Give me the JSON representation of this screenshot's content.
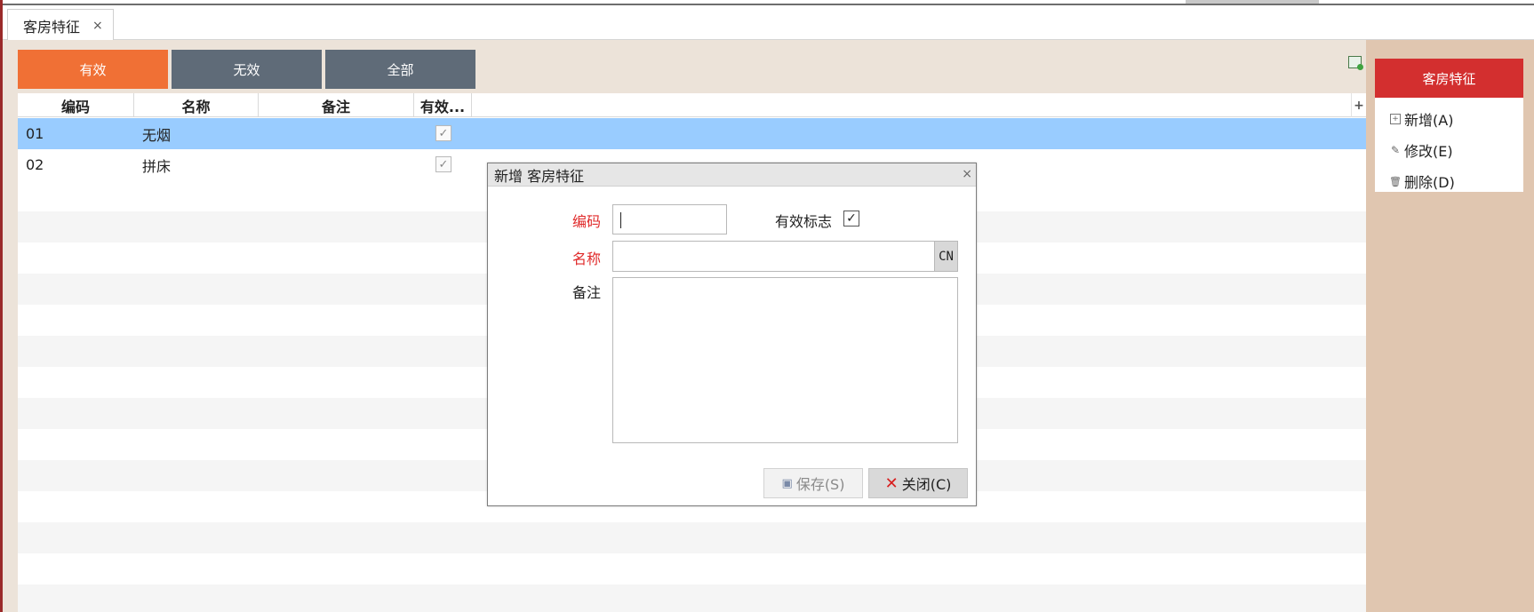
{
  "tab": {
    "title": "客房特征",
    "close": "×"
  },
  "filters": {
    "valid": "有效",
    "invalid": "无效",
    "all": "全部"
  },
  "table": {
    "columns": [
      "编码",
      "名称",
      "备注",
      "有效..."
    ],
    "add_icon": "+",
    "rows": [
      {
        "code": "01",
        "name": "无烟",
        "valid": true,
        "selected": true
      },
      {
        "code": "02",
        "name": "拼床",
        "valid": true,
        "selected": false
      }
    ]
  },
  "dialog": {
    "title": "新增 客房特征",
    "close": "×",
    "code_label": "编码",
    "name_label": "名称",
    "note_label": "备注",
    "flag_label": "有效标志",
    "flag_checked": true,
    "cn_button": "CN",
    "save_label": "保存(S)",
    "close_label": "关闭(C)"
  },
  "panel": {
    "title": "客房特征",
    "actions": [
      {
        "icon": "add-icon",
        "label": "新增(A)"
      },
      {
        "icon": "edit-icon",
        "label": "修改(E)"
      },
      {
        "icon": "delete-icon",
        "label": "删除(D)"
      }
    ]
  },
  "colors": {
    "accent": "#f07035",
    "secondary": "#5f6b78",
    "selected_row": "#99ccff",
    "panel_header": "#d32f2f",
    "required_label": "#e02a2a"
  }
}
